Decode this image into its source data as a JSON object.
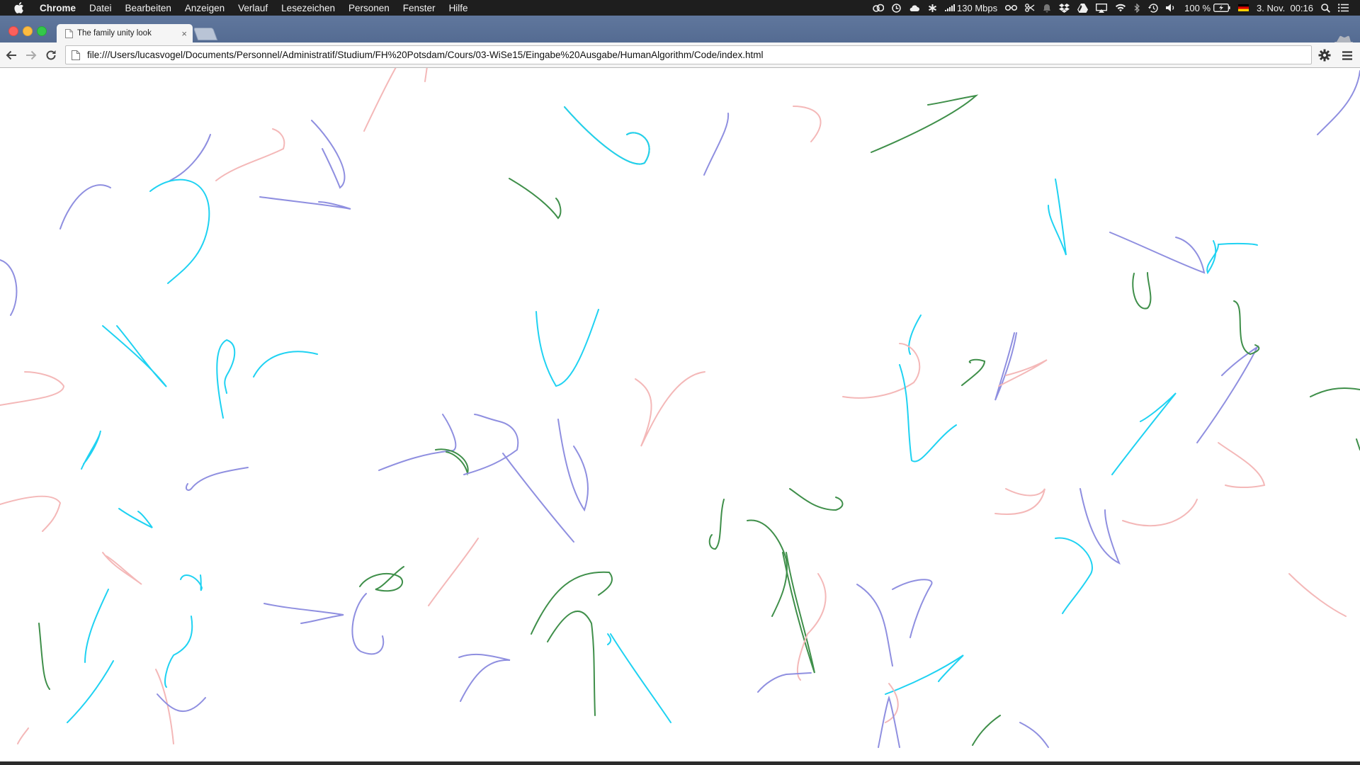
{
  "menubar": {
    "app_name": "Chrome",
    "items": [
      "Datei",
      "Bearbeiten",
      "Anzeigen",
      "Verlauf",
      "Lesezeichen",
      "Personen",
      "Fenster",
      "Hilfe"
    ],
    "network_speed": "130 Mbps",
    "battery": "100 %",
    "datetime": "3. Nov.  00:16"
  },
  "browser": {
    "tab_title": "The family unity look",
    "tab_close": "×",
    "url": "file:///Users/lucasvogel/Documents/Personnel/Administratif/Studium/FH%20Potsdam/Cours/03-WiSe15/Eingabe%20Ausgabe/HumanAlgorithm/Code/index.html"
  },
  "canvas": {
    "palette": {
      "green": "#3f8f4a",
      "cyan": "#1fd2f2",
      "purple": "#8f8fe0",
      "pink": "#f4b8b8"
    }
  }
}
